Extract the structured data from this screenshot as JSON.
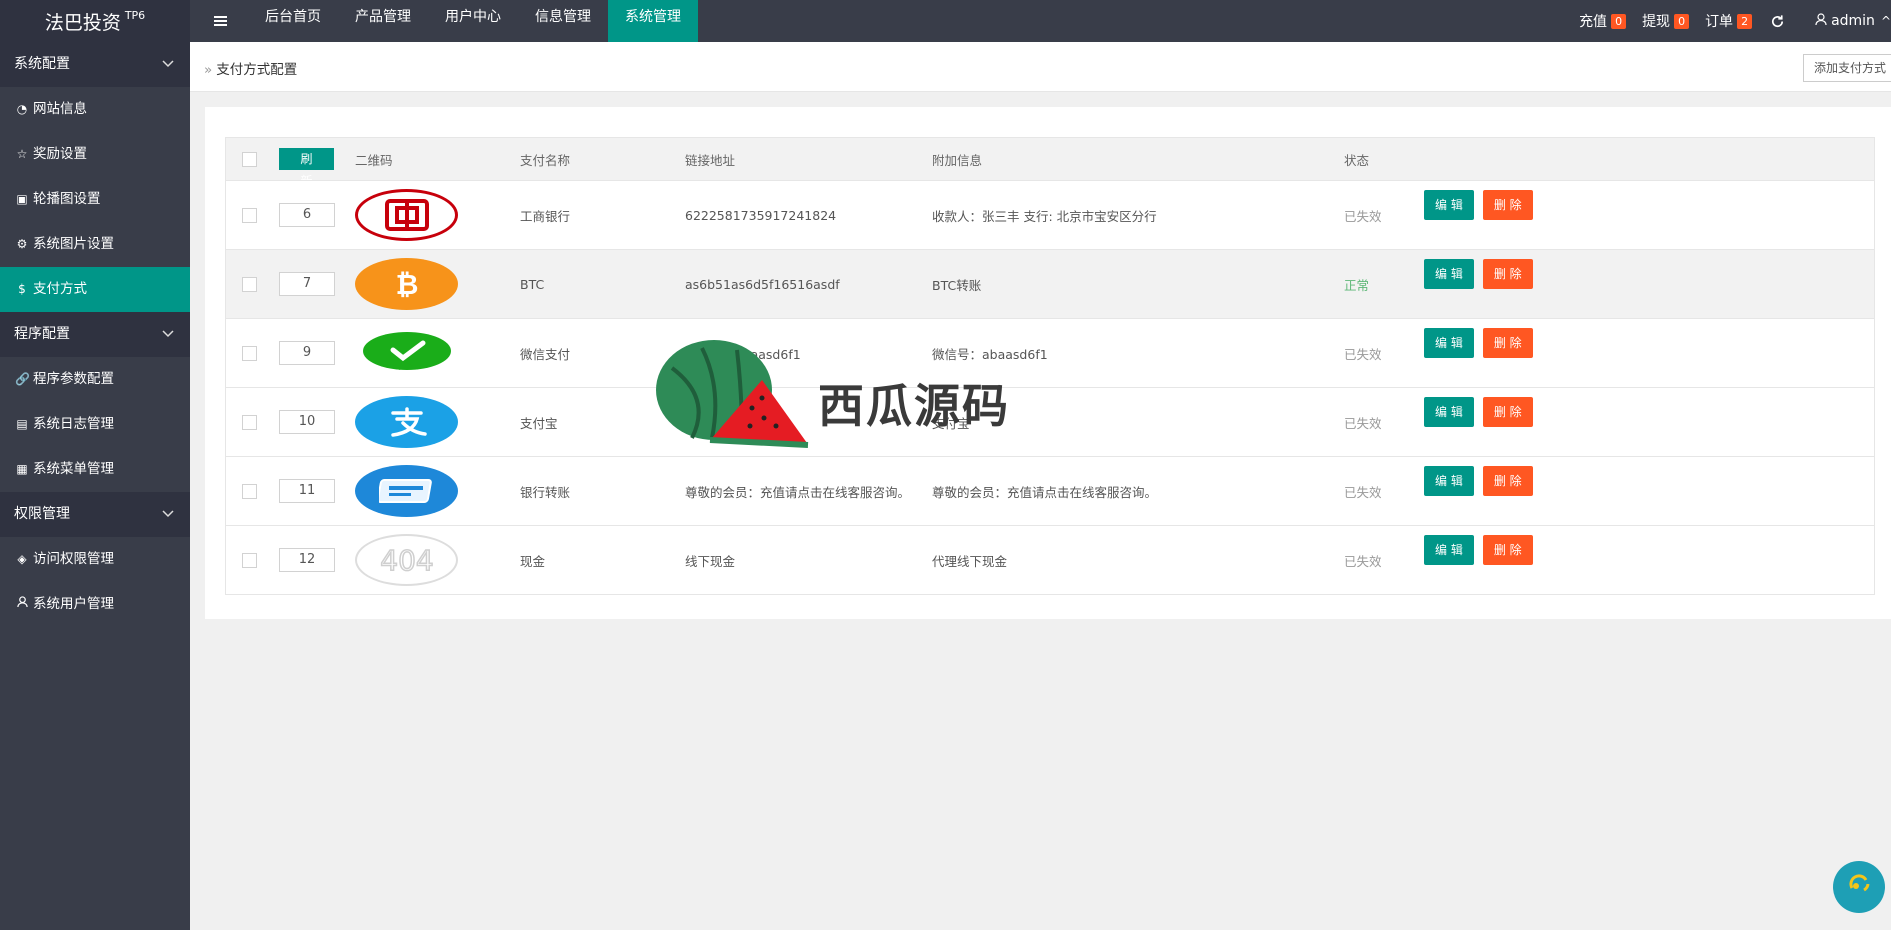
{
  "app": {
    "brand": "法巴投资",
    "brand_sup": "TP6"
  },
  "topnav": [
    {
      "label": "后台首页"
    },
    {
      "label": "产品管理"
    },
    {
      "label": "用户中心"
    },
    {
      "label": "信息管理"
    },
    {
      "label": "系统管理",
      "active": true
    }
  ],
  "topright": {
    "recharge": {
      "label": "充值",
      "count": "0"
    },
    "withdraw": {
      "label": "提现",
      "count": "0"
    },
    "orders": {
      "label": "订单",
      "count": "2"
    },
    "user": "admin"
  },
  "sidebar": {
    "groups": [
      {
        "title": "系统配置",
        "items": [
          {
            "label": "网站信息",
            "icon": "gauge-icon"
          },
          {
            "label": "奖励设置",
            "icon": "star-icon"
          },
          {
            "label": "轮播图设置",
            "icon": "image-icon"
          },
          {
            "label": "系统图片设置",
            "icon": "gear-icon"
          },
          {
            "label": "支付方式",
            "icon": "dollar-icon",
            "active": true
          }
        ]
      },
      {
        "title": "程序配置",
        "items": [
          {
            "label": "程序参数配置",
            "icon": "link-icon"
          },
          {
            "label": "系统日志管理",
            "icon": "log-icon"
          },
          {
            "label": "系统菜单管理",
            "icon": "menu-icon"
          }
        ]
      },
      {
        "title": "权限管理",
        "items": [
          {
            "label": "访问权限管理",
            "icon": "shield-icon"
          },
          {
            "label": "系统用户管理",
            "icon": "user-icon"
          }
        ]
      }
    ]
  },
  "breadcrumb": "支付方式配置",
  "add_button": "添加支付方式",
  "table": {
    "refresh": "刷 新",
    "headers": {
      "qr": "二维码",
      "name": "支付名称",
      "link": "链接地址",
      "info": "附加信息",
      "status": "状态"
    },
    "edit_label": "编 辑",
    "delete_label": "删 除",
    "rows": [
      {
        "sort": "6",
        "qr_icon": "icbc-logo-icon",
        "name": "工商银行",
        "link": "6222581735917241824",
        "info": "收款人：张三丰 支行: 北京市宝安区分行",
        "status": "已失效",
        "ok": false
      },
      {
        "sort": "7",
        "qr_icon": "bitcoin-logo-icon",
        "name": "BTC",
        "link": "as6b51as6d5f16516asdf",
        "info": "BTC转账",
        "status": "正常",
        "ok": true
      },
      {
        "sort": "9",
        "qr_icon": "wechat-logo-icon",
        "name": "微信支付",
        "link": "微信号：abaasd6f1",
        "info": "微信号：abaasd6f1",
        "status": "已失效",
        "ok": false
      },
      {
        "sort": "10",
        "qr_icon": "alipay-logo-icon",
        "name": "支付宝",
        "link": "",
        "info": "支付宝",
        "status": "已失效",
        "ok": false
      },
      {
        "sort": "11",
        "qr_icon": "unionpay-logo-icon",
        "name": "银行转账",
        "link": "尊敬的会员：充值请点击在线客服咨询。",
        "info": "尊敬的会员：充值请点击在线客服咨询。",
        "status": "已失效",
        "ok": false
      },
      {
        "sort": "12",
        "qr_icon": "404-image-icon",
        "name": "现金",
        "link": "线下现金",
        "info": "代理线下现金",
        "status": "已失效",
        "ok": false
      }
    ]
  },
  "watermark": {
    "text": "西瓜源码"
  },
  "colors": {
    "accent": "#009688",
    "danger": "#ff5722",
    "sidebar": "#393d49",
    "ok": "#5fb878"
  }
}
